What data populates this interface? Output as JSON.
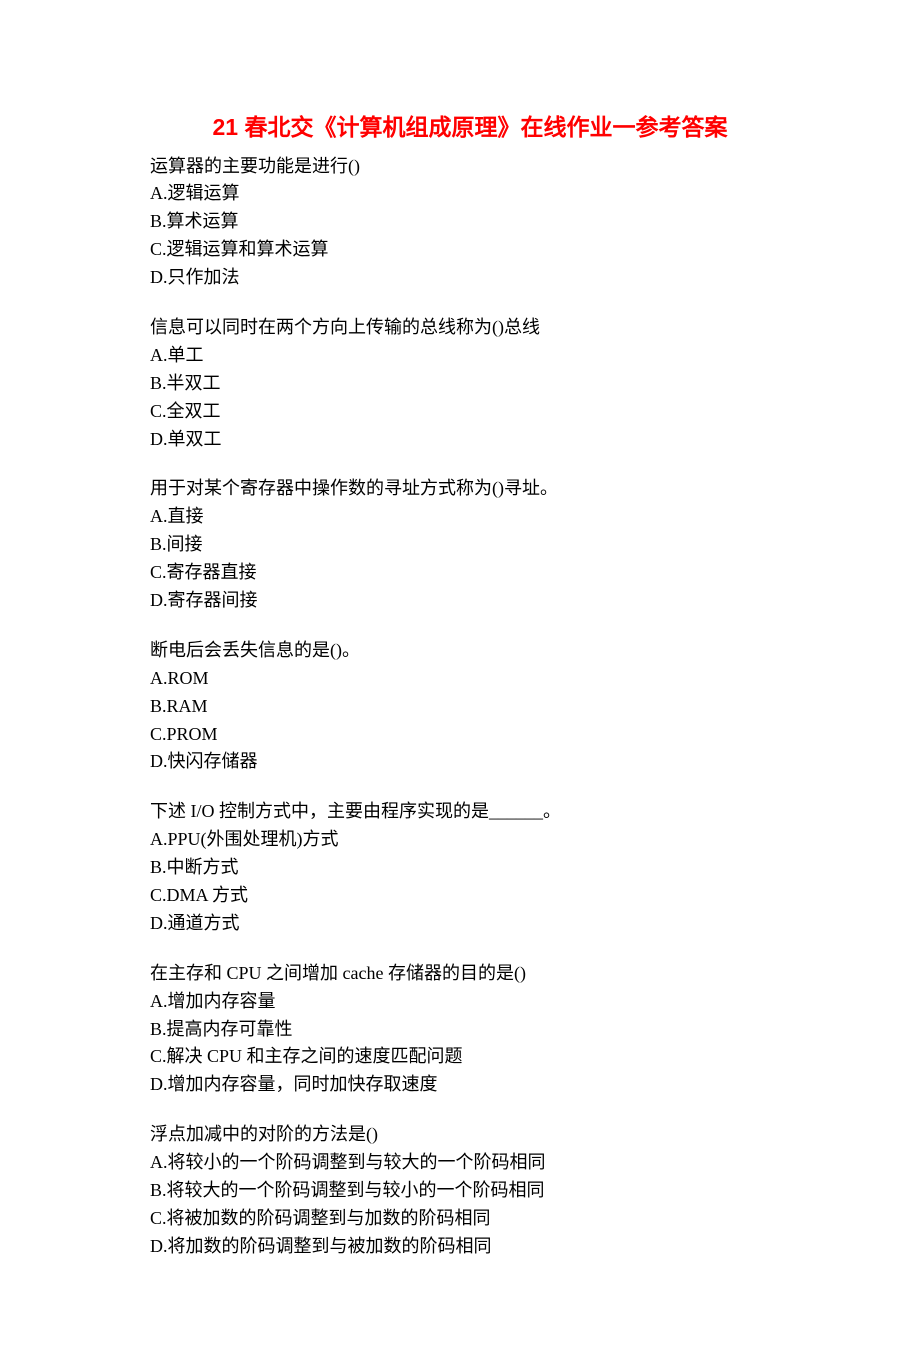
{
  "title": "21 春北交《计算机组成原理》在线作业一参考答案",
  "questions": [
    {
      "text": "运算器的主要功能是进行()",
      "options": [
        "A.逻辑运算",
        "B.算术运算",
        "C.逻辑运算和算术运算",
        "D.只作加法"
      ]
    },
    {
      "text": "信息可以同时在两个方向上传输的总线称为()总线",
      "options": [
        "A.单工",
        "B.半双工",
        "C.全双工",
        "D.单双工"
      ]
    },
    {
      "text": "用于对某个寄存器中操作数的寻址方式称为()寻址。",
      "options": [
        "A.直接",
        "B.间接",
        "C.寄存器直接",
        "D.寄存器间接"
      ]
    },
    {
      "text": "断电后会丢失信息的是()。",
      "options": [
        "A.ROM",
        "B.RAM",
        "C.PROM",
        "D.快闪存储器"
      ]
    },
    {
      "text": "下述 I/O 控制方式中，主要由程序实现的是______。",
      "options": [
        "A.PPU(外围处理机)方式",
        "B.中断方式",
        "C.DMA 方式",
        "D.通道方式"
      ]
    },
    {
      "text": "在主存和 CPU 之间增加 cache 存储器的目的是()",
      "options": [
        "A.增加内存容量",
        "B.提高内存可靠性",
        "C.解决 CPU 和主存之间的速度匹配问题",
        "D.增加内存容量，同时加快存取速度"
      ]
    },
    {
      "text": "浮点加减中的对阶的方法是()",
      "options": [
        "A.将较小的一个阶码调整到与较大的一个阶码相同",
        "B.将较大的一个阶码调整到与较小的一个阶码相同",
        "C.将被加数的阶码调整到与加数的阶码相同",
        "D.将加数的阶码调整到与被加数的阶码相同"
      ]
    }
  ]
}
